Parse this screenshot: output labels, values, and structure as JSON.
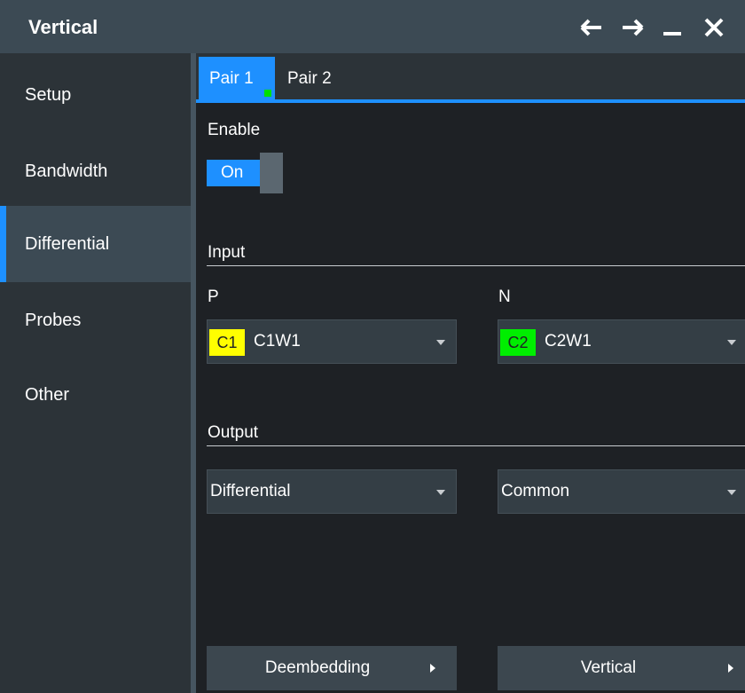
{
  "window": {
    "title": "Vertical",
    "controls": [
      "back-icon",
      "forward-icon",
      "minimize-icon",
      "close-icon"
    ]
  },
  "sidebar": {
    "items": [
      {
        "label": "Setup",
        "active": false
      },
      {
        "label": "Bandwidth",
        "active": false
      },
      {
        "label": "Differential",
        "active": true
      },
      {
        "label": "Probes",
        "active": false
      },
      {
        "label": "Other",
        "active": false
      }
    ]
  },
  "tabs": [
    {
      "label": "Pair 1",
      "active": true
    },
    {
      "label": "Pair 2",
      "active": false
    }
  ],
  "enable": {
    "label": "Enable",
    "state": "On"
  },
  "input": {
    "heading": "Input",
    "p": {
      "label": "P",
      "channel": "C1",
      "value": "C1W1",
      "channel_color": "#ffff00"
    },
    "n": {
      "label": "N",
      "channel": "C2",
      "value": "C2W1",
      "channel_color": "#00ee00"
    }
  },
  "output": {
    "heading": "Output",
    "left": "Differential",
    "right": "Common"
  },
  "buttons": {
    "deembedding": "Deembedding",
    "vertical": "Vertical"
  },
  "colors": {
    "accent": "#1e90ff",
    "active_indicator": "#00e000"
  }
}
